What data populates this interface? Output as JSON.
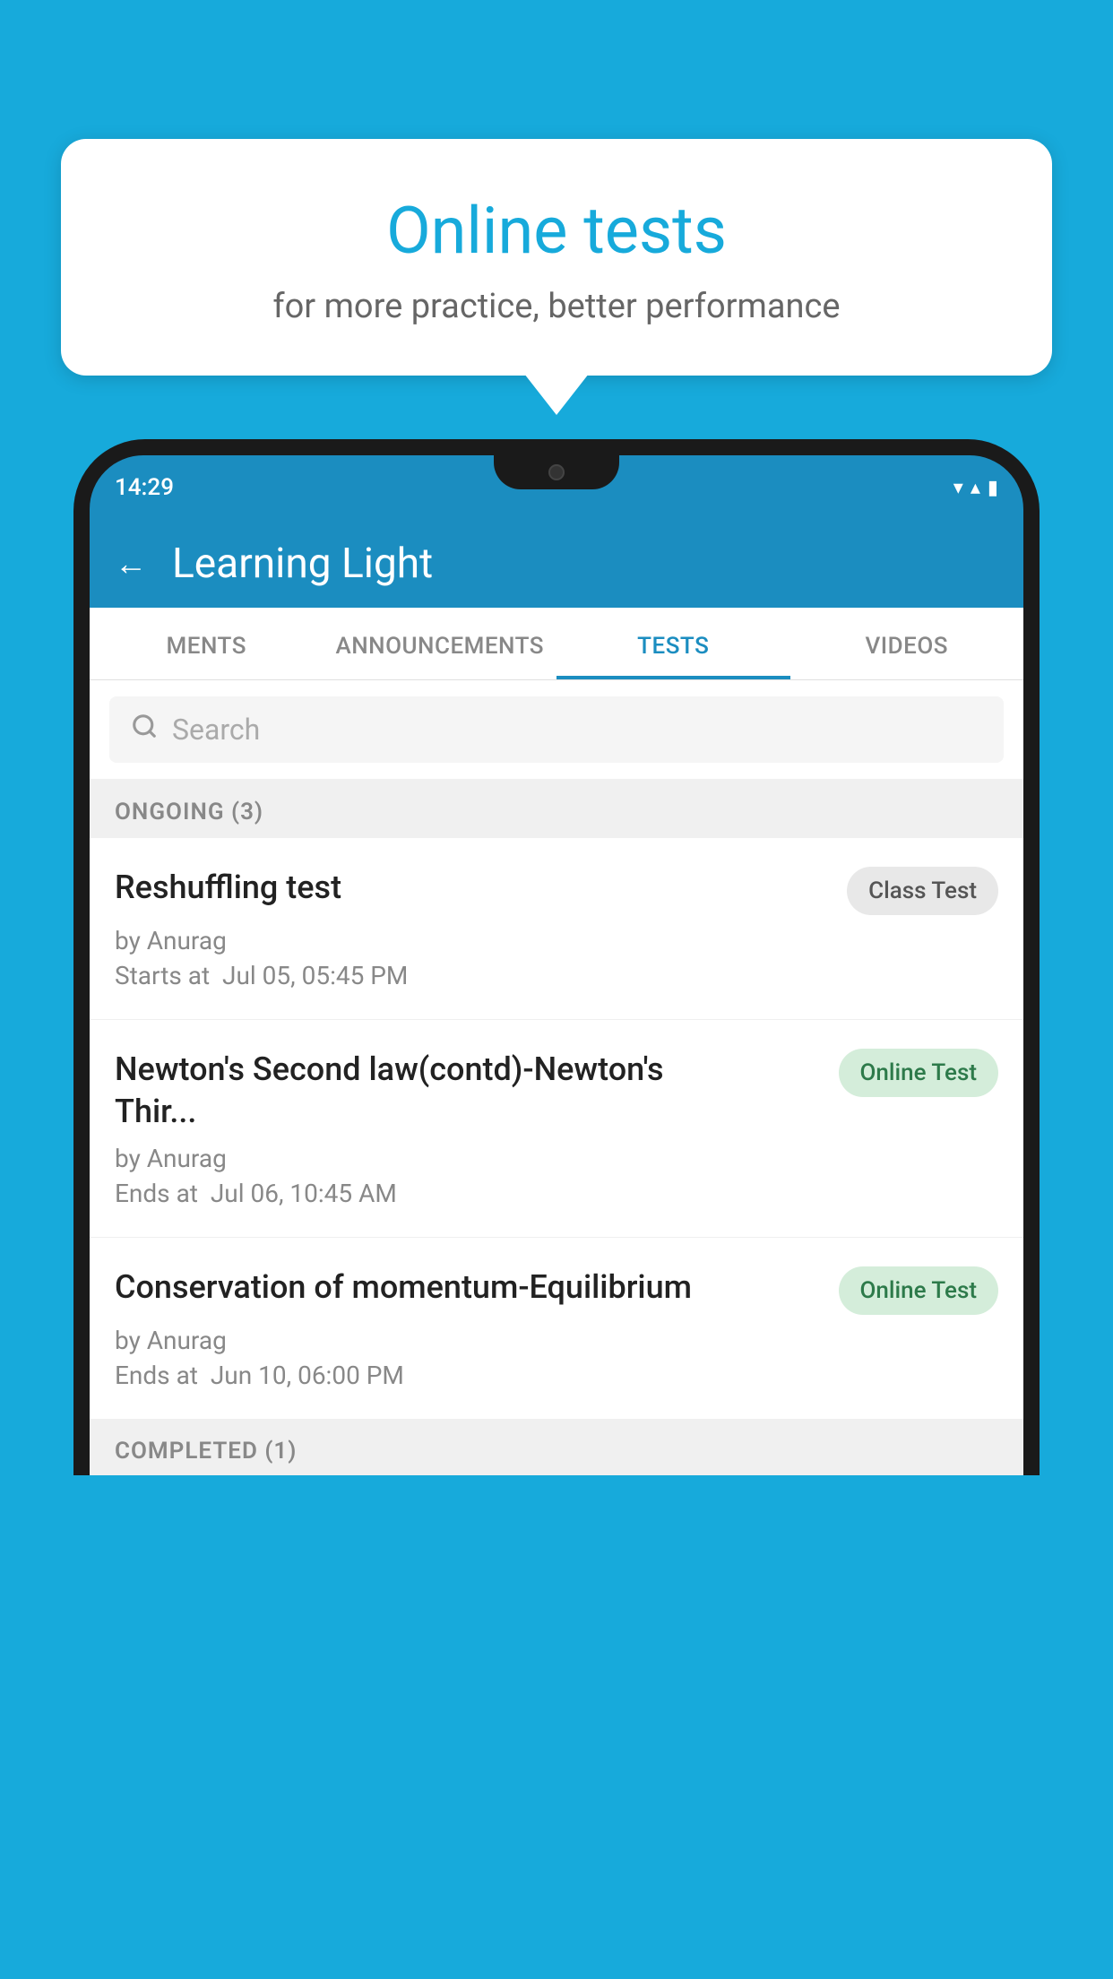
{
  "background": {
    "color": "#17AADB"
  },
  "speech_bubble": {
    "title": "Online tests",
    "subtitle": "for more practice, better performance"
  },
  "phone": {
    "status_bar": {
      "time": "14:29",
      "wifi_icon": "▾",
      "signal_icon": "▴",
      "battery_icon": "▮"
    },
    "app_header": {
      "back_label": "←",
      "title": "Learning Light"
    },
    "tabs": [
      {
        "label": "MENTS",
        "active": false
      },
      {
        "label": "ANNOUNCEMENTS",
        "active": false
      },
      {
        "label": "TESTS",
        "active": true
      },
      {
        "label": "VIDEOS",
        "active": false
      }
    ],
    "search": {
      "placeholder": "Search"
    },
    "ongoing_section": {
      "title": "ONGOING (3)"
    },
    "tests": [
      {
        "name": "Reshuffling test",
        "badge": "Class Test",
        "badge_type": "class",
        "by": "by Anurag",
        "time_label": "Starts at",
        "time": "Jul 05, 05:45 PM"
      },
      {
        "name": "Newton's Second law(contd)-Newton's Thir...",
        "badge": "Online Test",
        "badge_type": "online",
        "by": "by Anurag",
        "time_label": "Ends at",
        "time": "Jul 06, 10:45 AM"
      },
      {
        "name": "Conservation of momentum-Equilibrium",
        "badge": "Online Test",
        "badge_type": "online",
        "by": "by Anurag",
        "time_label": "Ends at",
        "time": "Jun 10, 06:00 PM"
      }
    ],
    "completed_section": {
      "title": "COMPLETED (1)"
    }
  }
}
